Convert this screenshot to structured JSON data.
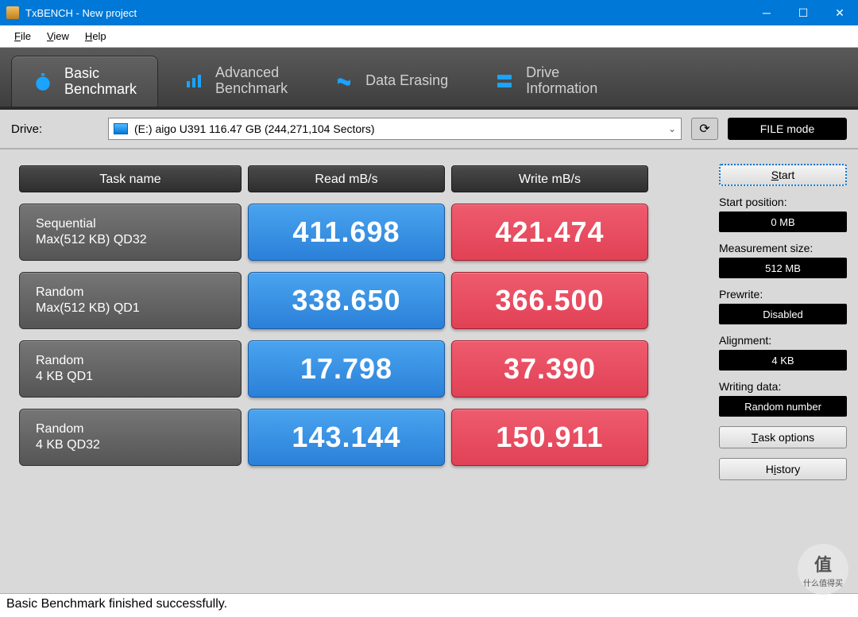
{
  "window": {
    "title": "TxBENCH - New project"
  },
  "menu": {
    "file": "File",
    "view": "View",
    "help": "Help"
  },
  "tabs": {
    "basic": {
      "l1": "Basic",
      "l2": "Benchmark"
    },
    "advanced": {
      "l1": "Advanced",
      "l2": "Benchmark"
    },
    "erasing": "Data Erasing",
    "drive": {
      "l1": "Drive",
      "l2": "Information"
    }
  },
  "drive": {
    "label": "Drive:",
    "selected": "(E:) aigo U391  116.47 GB (244,271,104 Sectors)",
    "filemode": "FILE mode"
  },
  "table": {
    "head": {
      "task": "Task name",
      "read": "Read mB/s",
      "write": "Write mB/s"
    },
    "rows": [
      {
        "name1": "Sequential",
        "name2": "Max(512 KB) QD32",
        "read": "411.698",
        "write": "421.474"
      },
      {
        "name1": "Random",
        "name2": "Max(512 KB) QD1",
        "read": "338.650",
        "write": "366.500"
      },
      {
        "name1": "Random",
        "name2": "4 KB QD1",
        "read": "17.798",
        "write": "37.390"
      },
      {
        "name1": "Random",
        "name2": "4 KB QD32",
        "read": "143.144",
        "write": "150.911"
      }
    ]
  },
  "sidebar": {
    "start": "Start",
    "startpos_label": "Start position:",
    "startpos": "0 MB",
    "meassize_label": "Measurement size:",
    "meassize": "512 MB",
    "prewrite_label": "Prewrite:",
    "prewrite": "Disabled",
    "align_label": "Alignment:",
    "align": "4 KB",
    "writedata_label": "Writing data:",
    "writedata": "Random number",
    "taskopt": "Task options",
    "history": "History"
  },
  "status": "Basic Benchmark finished successfully.",
  "watermark": {
    "char": "值",
    "text": "什么值得买"
  },
  "chart_data": {
    "type": "table",
    "title": "TxBENCH Basic Benchmark Results",
    "columns": [
      "Task name",
      "Read mB/s",
      "Write mB/s"
    ],
    "rows": [
      [
        "Sequential Max(512 KB) QD32",
        411.698,
        421.474
      ],
      [
        "Random Max(512 KB) QD1",
        338.65,
        366.5
      ],
      [
        "Random 4 KB QD1",
        17.798,
        37.39
      ],
      [
        "Random 4 KB QD32",
        143.144,
        150.911
      ]
    ]
  }
}
